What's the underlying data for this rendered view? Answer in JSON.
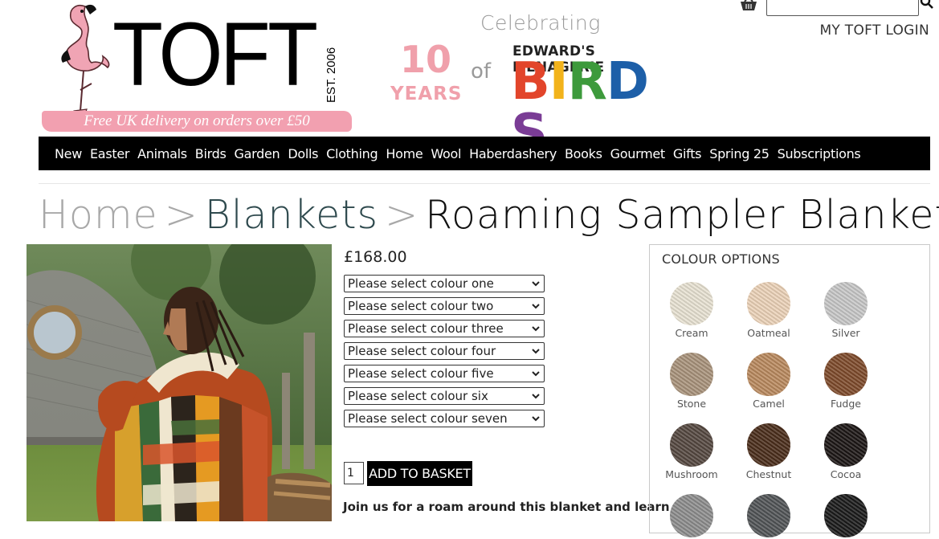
{
  "header": {
    "logo_text": "TOFT",
    "logo_est": "EST. 2006",
    "delivery_banner": "Free UK delivery on orders over £50",
    "promo": {
      "celebrating": "Celebrating",
      "ten": "10",
      "years": "YEARS",
      "of": "of",
      "menagerie": "EDWARD'S MENAGERIE",
      "birds_letters": [
        {
          "letter": "B",
          "color": "#e2452b"
        },
        {
          "letter": "I",
          "color": "#f2b31b"
        },
        {
          "letter": "R",
          "color": "#3d9a3c"
        },
        {
          "letter": "D",
          "color": "#1d5fa8"
        },
        {
          "letter": "S",
          "color": "#7a3c95"
        }
      ]
    },
    "login_label": "MY TOFT LOGIN",
    "search_placeholder": ""
  },
  "nav": {
    "items": [
      "New",
      "Easter",
      "Animals",
      "Birds",
      "Garden",
      "Dolls",
      "Clothing",
      "Home",
      "Wool",
      "Haberdashery",
      "Books",
      "Gourmet",
      "Gifts",
      "Spring 25",
      "Subscriptions"
    ]
  },
  "breadcrumb": {
    "home": "Home",
    "separator": ">",
    "category": "Blankets",
    "current": "Roaming Sampler Blanket"
  },
  "product": {
    "price": "£168.00",
    "colour_selects": [
      "Please select colour one",
      "Please select colour two",
      "Please select colour three",
      "Please select colour four",
      "Please select colour five",
      "Please select colour six",
      "Please select colour seven"
    ],
    "quantity": "1",
    "add_to_basket": "ADD TO BASKET",
    "intro_text": "Join us for a roam around this blanket and learn"
  },
  "colour_options": {
    "title": "COLOUR OPTIONS",
    "swatches": [
      {
        "name": "Cream",
        "color": "#e8e2d2"
      },
      {
        "name": "Oatmeal",
        "color": "#ecd2b8"
      },
      {
        "name": "Silver",
        "color": "#c7c7c7"
      },
      {
        "name": "Stone",
        "color": "#a8927a"
      },
      {
        "name": "Camel",
        "color": "#b9895d"
      },
      {
        "name": "Fudge",
        "color": "#7e4a2a"
      },
      {
        "name": "Mushroom",
        "color": "#54473f"
      },
      {
        "name": "Chestnut",
        "color": "#4a2c1a"
      },
      {
        "name": "Cocoa",
        "color": "#1b1514"
      },
      {
        "name": "",
        "color": "#8c8c8c"
      },
      {
        "name": "",
        "color": "#505356"
      },
      {
        "name": "",
        "color": "#1a1a1a"
      }
    ]
  }
}
